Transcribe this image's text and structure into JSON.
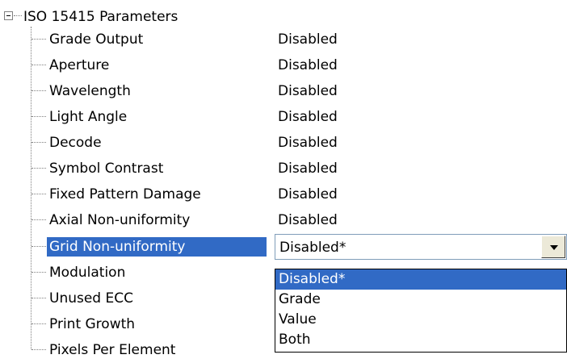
{
  "tree": {
    "root_label": "ISO 15415 Parameters",
    "rows": [
      {
        "label": "Grade Output",
        "value": "Disabled"
      },
      {
        "label": "Aperture",
        "value": "Disabled"
      },
      {
        "label": "Wavelength",
        "value": "Disabled"
      },
      {
        "label": "Light Angle",
        "value": "Disabled"
      },
      {
        "label": "Decode",
        "value": "Disabled"
      },
      {
        "label": "Symbol Contrast",
        "value": "Disabled"
      },
      {
        "label": "Fixed Pattern Damage",
        "value": "Disabled"
      },
      {
        "label": "Axial Non-uniformity",
        "value": "Disabled"
      },
      {
        "label": "Grid Non-uniformity",
        "value": ""
      },
      {
        "label": "Modulation",
        "value": ""
      },
      {
        "label": "Unused ECC",
        "value": ""
      },
      {
        "label": "Print Growth",
        "value": ""
      },
      {
        "label": "Pixels Per Element",
        "value": ""
      }
    ],
    "selected_row": "Grid Non-uniformity"
  },
  "combo": {
    "selected_value": "Disabled*",
    "options": [
      "Disabled*",
      "Grade",
      "Value",
      "Both"
    ],
    "highlighted_option": "Disabled*"
  },
  "icons": {
    "expander": "collapse-minus-icon",
    "dropdown_arrow": "chevron-down-icon"
  },
  "colors": {
    "selection": "#316ac5",
    "selection_text": "#ffffff"
  }
}
